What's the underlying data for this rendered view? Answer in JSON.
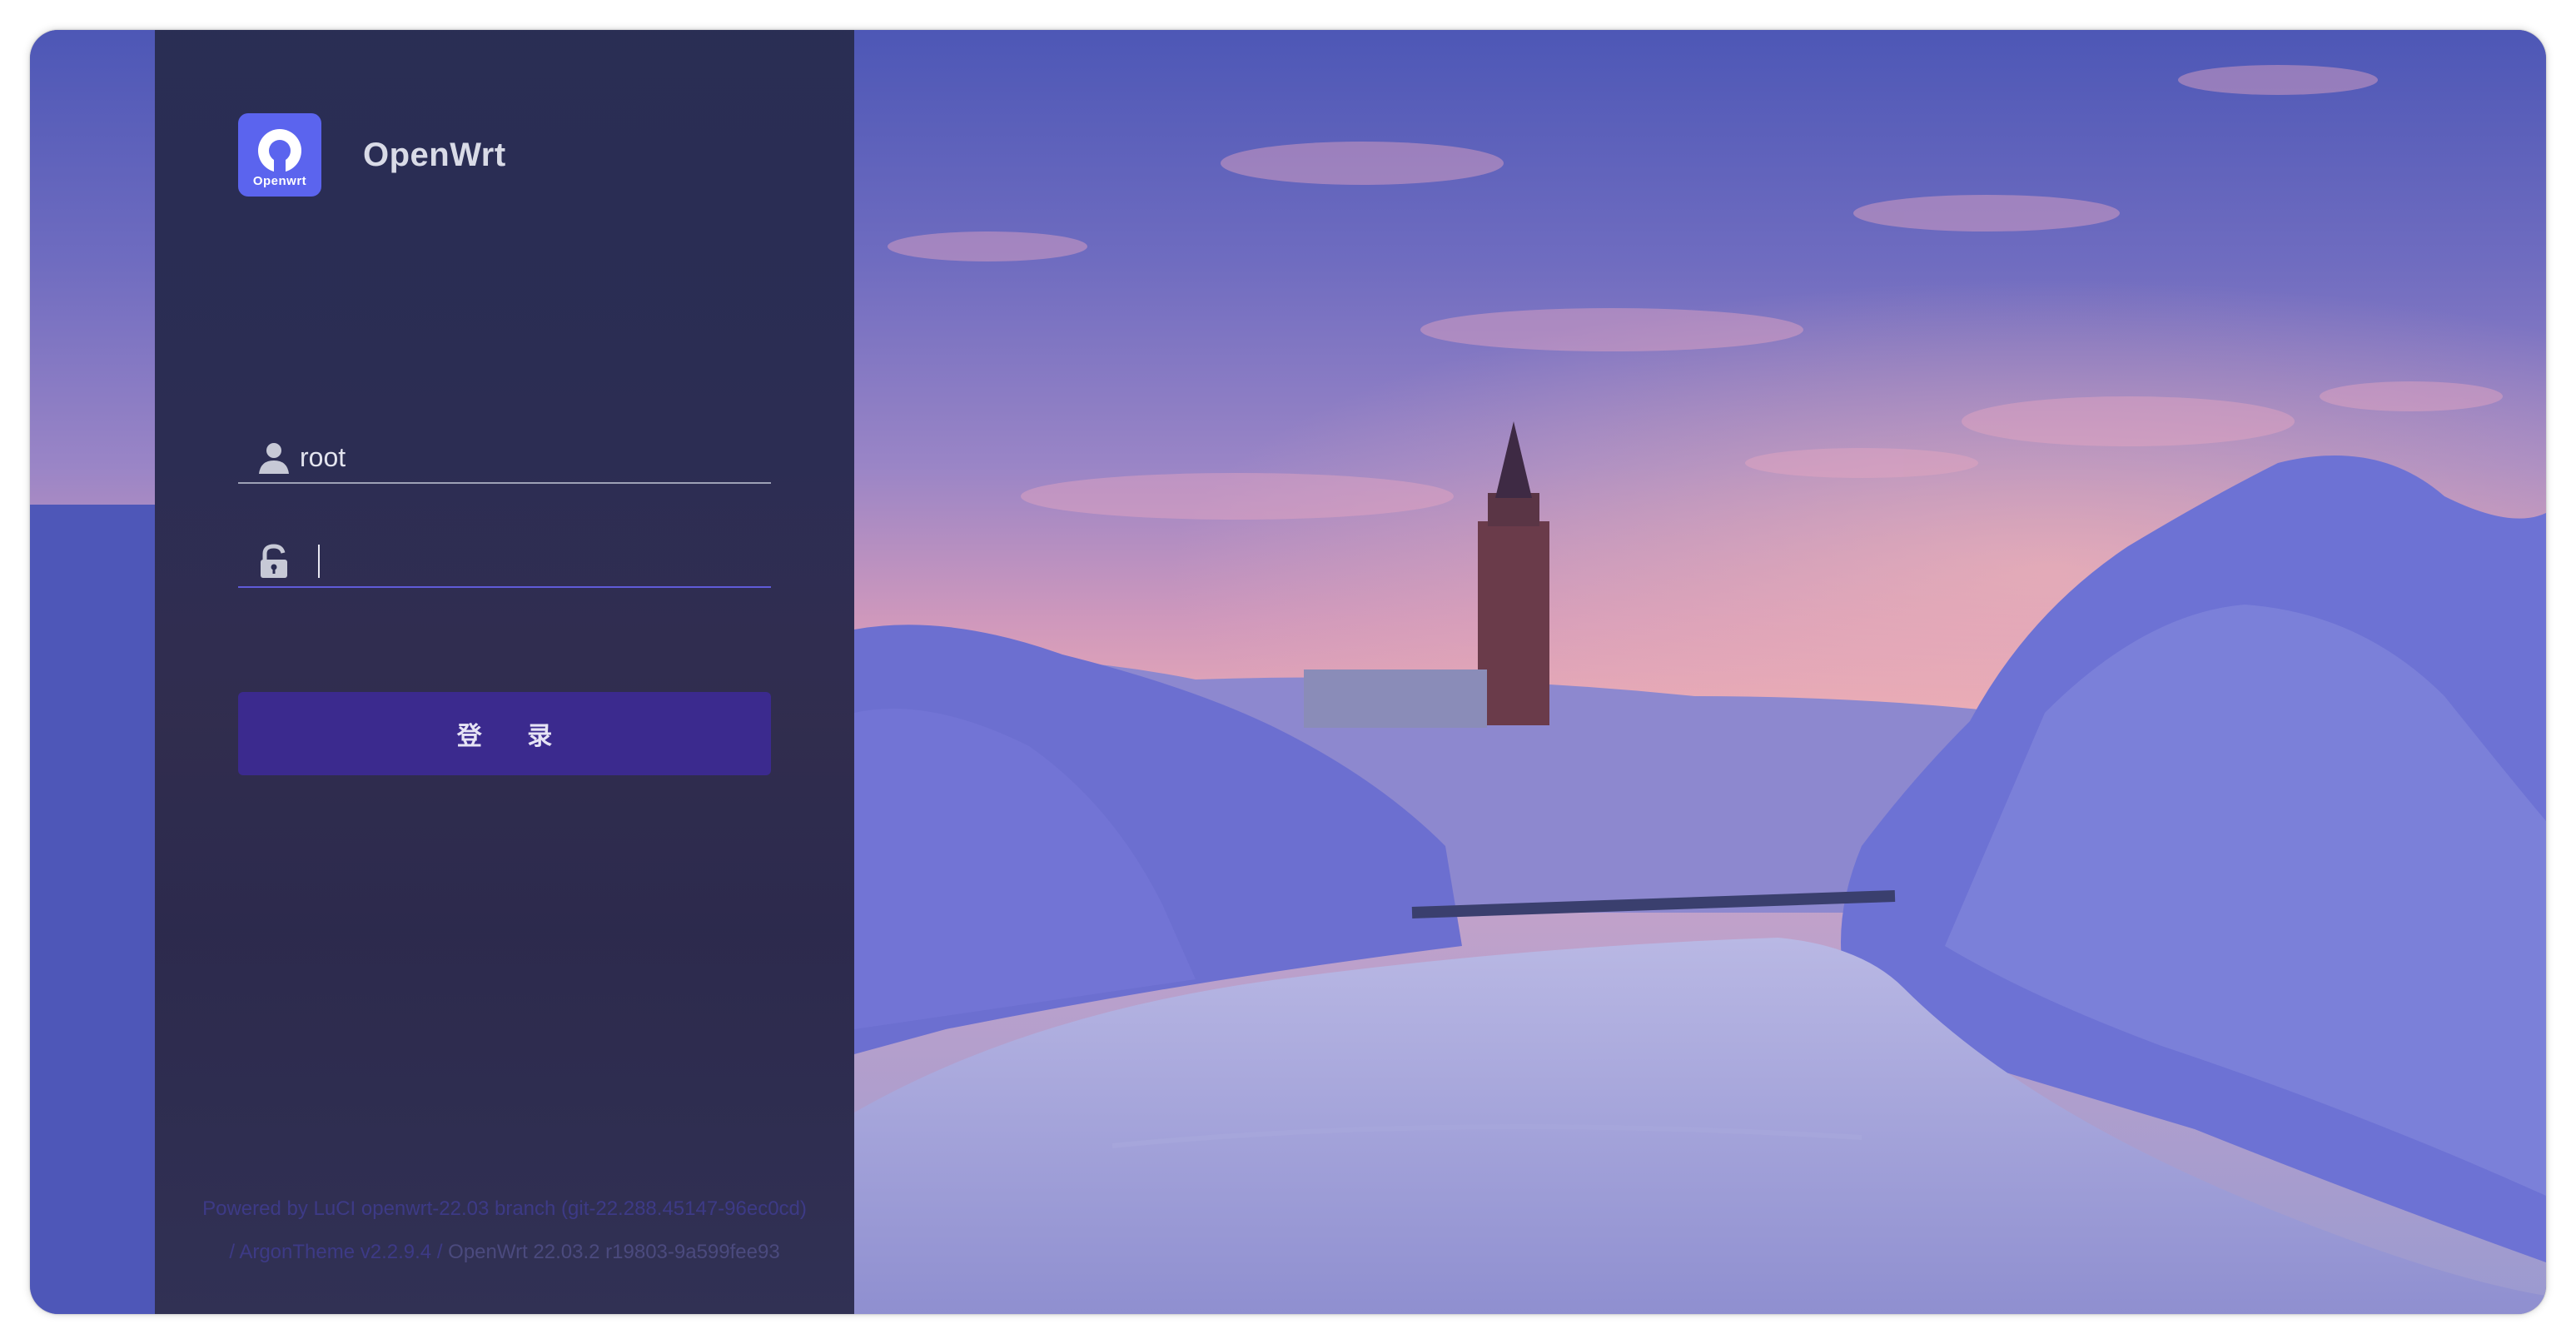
{
  "brand": {
    "name": "OpenWrt",
    "logo_caption": "Openwrt"
  },
  "login": {
    "username_value": "root",
    "password_value": "",
    "submit_label": "登 录"
  },
  "footer": {
    "powered_prefix": "Powered by",
    "luci_link": "LuCI openwrt-22.03 branch (git-22.288.45147-96ec0cd)",
    "separator1": "/",
    "theme_link": "ArgonTheme v2.2.9.4",
    "separator2": "/",
    "firmware": "OpenWrt 22.03.2 r19803-9a599fee93"
  },
  "icons": {
    "user": "user-icon",
    "password": "lock-icon",
    "logo": "openwrt-logo-icon"
  },
  "colors": {
    "accent": "#5b64ee",
    "button": "#3b2a8e",
    "panel": "#282c50"
  }
}
